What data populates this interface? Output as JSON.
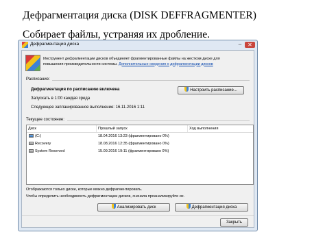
{
  "slide": {
    "title": "Дефрагментация диска (DISK DEFFRAGMENTER)",
    "subtitle": "Собирает файлы, устраняя их дробление."
  },
  "window": {
    "title": "Дефрагментация диска",
    "controls": {
      "minimize": "–",
      "close": "✕"
    }
  },
  "intro": {
    "line1": "Инструмент дефрагментации дисков объединяет фрагментированные файлы на жестком диске для",
    "line2_prefix": "повышения производительности системы. ",
    "link": "Дополнительные сведения о дефрагментации дисков"
  },
  "schedule": {
    "section_label": "Расписание:",
    "enabled_text": "Дефрагментация по расписанию включена",
    "run_text": "Запускать в 1:00 каждая среда",
    "next_text": "Следующее запланированное выполнение: 16.11.2016 1:11",
    "configure_button": "Настроить расписание..."
  },
  "status": {
    "section_label": "Текущее состояние:",
    "columns": [
      "Диск",
      "Прошлый запуск",
      "Ход выполнения"
    ],
    "rows": [
      {
        "disk": "(C:)",
        "last_run": "18.04.2016 13:23 (фрагментировано 0%)",
        "progress": ""
      },
      {
        "disk": "Recovery",
        "last_run": "18.08.2016 12:35 (фрагментировано 0%)",
        "progress": ""
      },
      {
        "disk": "System Reserved",
        "last_run": "15.09.2016 19:11 (фрагментировано 0%)",
        "progress": ""
      }
    ]
  },
  "footer": {
    "note1": "Отображаются только диски, которые можно дефрагментировать.",
    "note2": "Чтобы определить необходимость дефрагментации дисков, сначала проанализируйте их.",
    "analyze_button": "Анализировать диск",
    "defrag_button": "Дефрагментация диска",
    "close_button": "Закрыть"
  }
}
